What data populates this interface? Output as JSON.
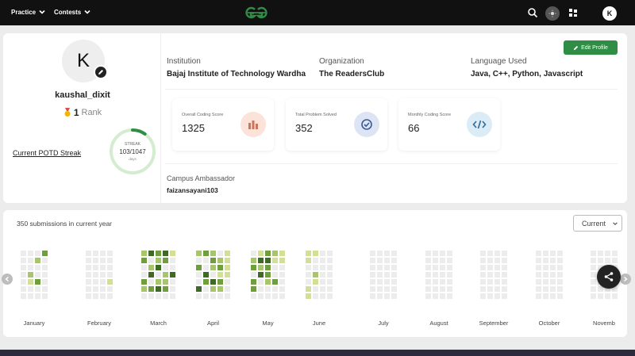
{
  "nav": {
    "practice": "Practice",
    "contests": "Contests",
    "avatar_initial": "K"
  },
  "profile": {
    "avatar_initial": "K",
    "username": "kaushal_dixit",
    "rank_number": "1",
    "rank_label": "Rank",
    "potd_link": "Current POTD Streak",
    "streak": {
      "label": "STREAK",
      "value": "103/1047",
      "unit": "days",
      "progress": 0.098
    },
    "edit_button": "Edit Profile",
    "institution": {
      "label": "Institution",
      "value": "Bajaj Institute of Technology Wardha"
    },
    "organization": {
      "label": "Organization",
      "value": "The ReadersClub"
    },
    "language": {
      "label": "Language Used",
      "value": "Java, C++, Python, Javascript"
    },
    "scores": [
      {
        "label": "Overall Coding Score",
        "value": "1325",
        "icon": "bar-chart-icon"
      },
      {
        "label": "Total Problem Solved",
        "value": "352",
        "icon": "check-circle-icon"
      },
      {
        "label": "Monthly Coding Score",
        "value": "66",
        "icon": "code-icon"
      }
    ],
    "ambassador": {
      "label": "Campus Ambassador",
      "value": "faizansayani103"
    }
  },
  "heatmap": {
    "submissions_text": "350 submissions in current year",
    "select_value": "Current",
    "months": [
      {
        "name": "January",
        "cols": [
          [
            0,
            0,
            0,
            0,
            0,
            0,
            0
          ],
          [
            0,
            0,
            0,
            2,
            1,
            0,
            0
          ],
          [
            0,
            2,
            0,
            0,
            3,
            0,
            0
          ],
          [
            3,
            0,
            0,
            0,
            0,
            0,
            0
          ]
        ]
      },
      {
        "name": "February",
        "cols": [
          [
            0,
            0,
            0,
            0,
            0,
            0,
            0
          ],
          [
            0,
            0,
            0,
            0,
            0,
            0,
            0
          ],
          [
            0,
            0,
            0,
            0,
            0,
            0,
            0
          ],
          [
            0,
            0,
            0,
            0,
            1,
            0,
            0
          ]
        ]
      },
      {
        "name": "March",
        "cols": [
          [
            2,
            3,
            0,
            0,
            3,
            2,
            0
          ],
          [
            4,
            0,
            2,
            4,
            0,
            3,
            0
          ],
          [
            3,
            2,
            4,
            0,
            2,
            4,
            0
          ],
          [
            4,
            3,
            0,
            2,
            2,
            3,
            0
          ],
          [
            1,
            0,
            0,
            4,
            0,
            0,
            0
          ]
        ]
      },
      {
        "name": "April",
        "cols": [
          [
            2,
            0,
            3,
            0,
            0,
            4,
            0
          ],
          [
            3,
            0,
            0,
            4,
            3,
            0,
            0
          ],
          [
            2,
            3,
            2,
            0,
            4,
            2,
            0
          ],
          [
            0,
            2,
            3,
            1,
            3,
            2,
            0
          ],
          [
            1,
            1,
            1,
            1,
            0,
            0,
            0
          ]
        ]
      },
      {
        "name": "May",
        "cols": [
          [
            0,
            2,
            3,
            0,
            3,
            3,
            0
          ],
          [
            1,
            4,
            2,
            4,
            0,
            0,
            0
          ],
          [
            3,
            4,
            3,
            3,
            2,
            0,
            0
          ],
          [
            2,
            1,
            0,
            0,
            3,
            0,
            0
          ],
          [
            1,
            1,
            0,
            0,
            0,
            0,
            0
          ]
        ]
      },
      {
        "name": "June",
        "cols": [
          [
            1,
            1,
            0,
            0,
            0,
            1,
            1
          ],
          [
            1,
            0,
            0,
            2,
            1,
            0,
            0
          ],
          [
            0,
            0,
            0,
            0,
            0,
            0,
            0
          ],
          [
            0,
            0,
            0,
            0,
            0,
            0,
            0
          ]
        ]
      },
      {
        "name": "July",
        "cols": [
          [
            0,
            0,
            0,
            0,
            0,
            0,
            0
          ],
          [
            0,
            0,
            0,
            0,
            0,
            0,
            0
          ],
          [
            0,
            0,
            0,
            0,
            0,
            0,
            0
          ],
          [
            0,
            0,
            0,
            0,
            0,
            0,
            0
          ]
        ]
      },
      {
        "name": "August",
        "cols": [
          [
            0,
            0,
            0,
            0,
            0,
            0,
            0
          ],
          [
            0,
            0,
            0,
            0,
            0,
            0,
            0
          ],
          [
            0,
            0,
            0,
            0,
            0,
            0,
            0
          ],
          [
            0,
            0,
            0,
            0,
            0,
            0,
            0
          ]
        ]
      },
      {
        "name": "September",
        "cols": [
          [
            0,
            0,
            0,
            0,
            0,
            0,
            0
          ],
          [
            0,
            0,
            0,
            0,
            0,
            0,
            0
          ],
          [
            0,
            0,
            0,
            0,
            0,
            0,
            0
          ],
          [
            0,
            0,
            0,
            0,
            0,
            0,
            0
          ]
        ]
      },
      {
        "name": "October",
        "cols": [
          [
            0,
            0,
            0,
            0,
            0,
            0,
            0
          ],
          [
            0,
            0,
            0,
            0,
            0,
            0,
            0
          ],
          [
            0,
            0,
            0,
            0,
            0,
            0,
            0
          ],
          [
            0,
            0,
            0,
            0,
            0,
            0,
            0
          ]
        ]
      },
      {
        "name": "Novemb",
        "cols": [
          [
            0,
            0,
            0,
            0,
            0,
            0,
            0
          ],
          [
            0,
            0,
            0,
            0,
            0,
            0,
            0
          ],
          [
            0,
            0,
            0,
            0,
            0,
            0,
            0
          ],
          [
            0,
            0,
            0,
            0,
            0,
            0,
            0
          ]
        ]
      }
    ]
  },
  "colors": {
    "brand_green": "#2f8d46",
    "heat_levels": [
      "#ececec",
      "#d3df95",
      "#a7c66a",
      "#6f9f3c",
      "#3d6b21"
    ]
  }
}
